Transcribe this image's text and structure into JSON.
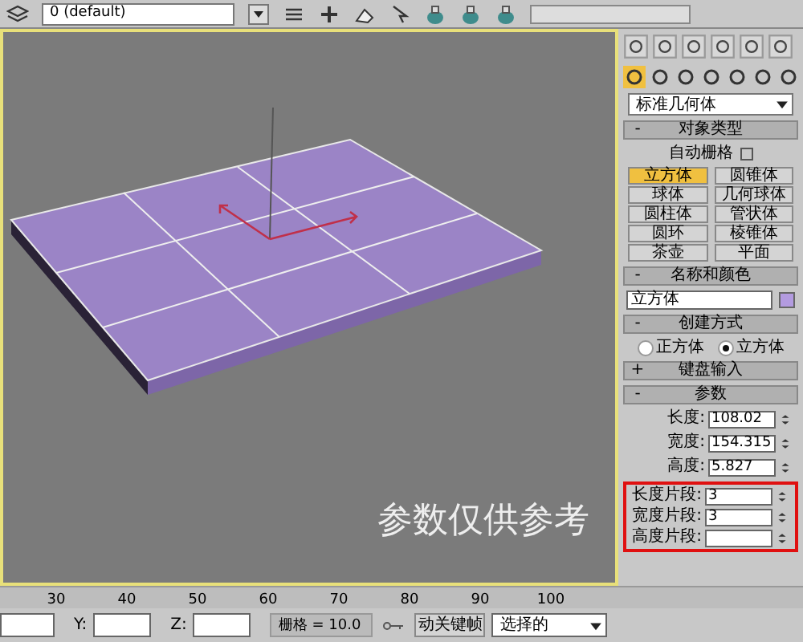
{
  "toolbar": {
    "layer_name": "0 (default)"
  },
  "viewport": {
    "annotation": "参数仅供参考"
  },
  "command_panel": {
    "category": "标准几何体",
    "object_type": {
      "toggle": "-",
      "title": "对象类型",
      "autogrid_label": "自动栅格",
      "autogrid_checked": false,
      "buttons": [
        {
          "label": "立方体",
          "selected": true
        },
        {
          "label": "圆锥体",
          "selected": false
        },
        {
          "label": "球体",
          "selected": false
        },
        {
          "label": "几何球体",
          "selected": false
        },
        {
          "label": "圆柱体",
          "selected": false
        },
        {
          "label": "管状体",
          "selected": false
        },
        {
          "label": "圆环",
          "selected": false
        },
        {
          "label": "棱锥体",
          "selected": false
        },
        {
          "label": "茶壶",
          "selected": false
        },
        {
          "label": "平面",
          "selected": false
        }
      ]
    },
    "name_and_color": {
      "toggle": "-",
      "title": "名称和颜色",
      "name": "立方体",
      "color": "#b39be0"
    },
    "creation_method": {
      "toggle": "-",
      "title": "创建方式",
      "options": [
        {
          "label": "正方体",
          "selected": false
        },
        {
          "label": "立方体",
          "selected": true
        }
      ]
    },
    "keyboard_entry": {
      "toggle": "+",
      "title": "键盘输入"
    },
    "parameters": {
      "toggle": "-",
      "title": "参数",
      "fields": [
        {
          "label": "长度:",
          "value": "108.02"
        },
        {
          "label": "宽度:",
          "value": "154.315"
        },
        {
          "label": "高度:",
          "value": "5.827"
        }
      ],
      "segment_fields": [
        {
          "label": "长度片段:",
          "value": "3"
        },
        {
          "label": "宽度片段:",
          "value": "3"
        },
        {
          "label": "高度片段:"
        }
      ]
    }
  },
  "timeline": {
    "ticks": [
      "30",
      "40",
      "50",
      "60",
      "70",
      "80",
      "90",
      "100"
    ]
  },
  "status_bar": {
    "y_label": "Y:",
    "z_label": "Z:",
    "grid": "栅格 = 10.0",
    "auto_key": "动关键帧",
    "selection": "选择的"
  }
}
